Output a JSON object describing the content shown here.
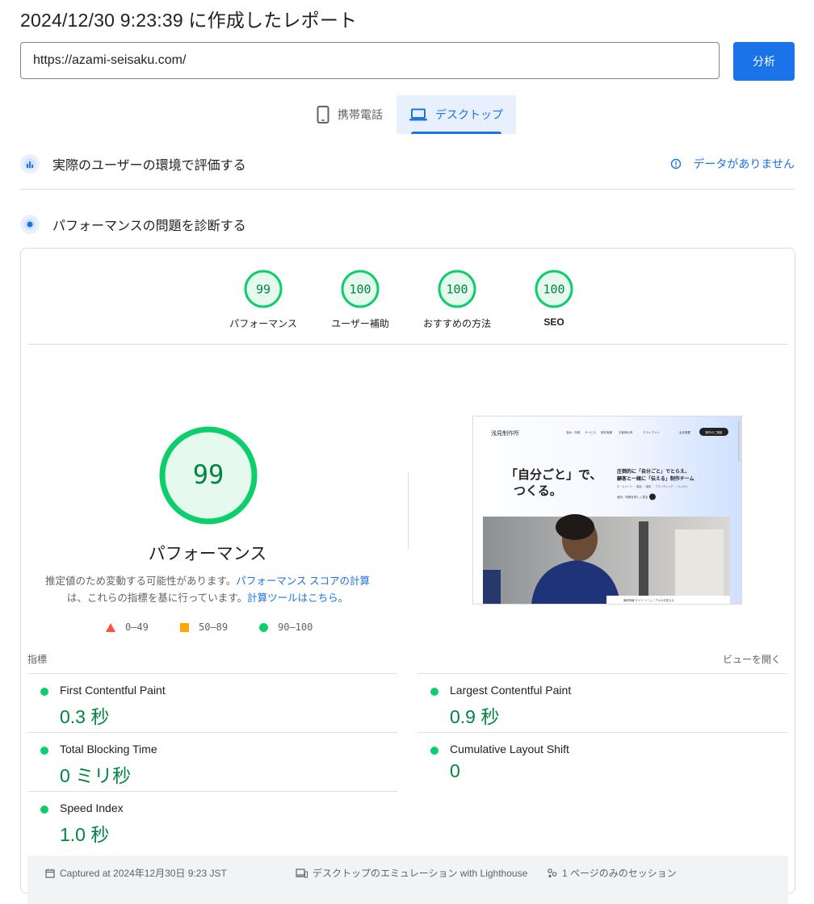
{
  "report": {
    "title": "2024/12/30 9:23:39 に作成したレポート",
    "url": "https://azami-seisaku.com/",
    "analyze_label": "分析"
  },
  "tabs": [
    {
      "label": "携帯電話",
      "icon": "phone-icon",
      "selected": false
    },
    {
      "label": "デスクトップ",
      "icon": "laptop-icon",
      "selected": true
    }
  ],
  "field_section": {
    "title": "実際のユーザーの環境で評価する",
    "icon": "field-data-icon",
    "status": "データがありません",
    "status_icon": "info-icon"
  },
  "lab_section": {
    "title": "パフォーマンスの問題を診断する",
    "icon": "lab-data-icon"
  },
  "scores": [
    {
      "label": "パフォーマンス",
      "value": "99"
    },
    {
      "label": "ユーザー補助",
      "value": "100"
    },
    {
      "label": "おすすめの方法",
      "value": "100"
    },
    {
      "label": "SEO",
      "value": "100"
    }
  ],
  "performance": {
    "score": "99",
    "label": "パフォーマンス",
    "note_prefix": "推定値のため変動する可能性があります。",
    "note_link1": "パフォーマンス スコアの計算",
    "note_middle": "は、これらの指標を基に行っています。",
    "note_link2": "計算ツールはこちら。"
  },
  "legend": [
    {
      "range": "0–49",
      "shape": "triangle",
      "color": "#ff4e42"
    },
    {
      "range": "50–89",
      "shape": "square",
      "color": "#ffa400"
    },
    {
      "range": "90–100",
      "shape": "circle",
      "color": "#0cce6b"
    }
  ],
  "screenshot": {
    "logo": "浅見制作所",
    "nav": [
      "強み・特長",
      "サービス",
      "制作実績",
      "お客様の声",
      "クライアント",
      "会社概要"
    ],
    "nav_cta": "制作のご相談",
    "headline_1": "「自分ごと」で、",
    "headline_2": "つくる。",
    "tagline_1": "圧倒的に「自分ごと」でとらえ、",
    "tagline_2": "顧客と一緒に「伝える」制作チーム",
    "tagline_small": "ホームページ ・ 動画 ・ 撮影 ・ ブランディング ・ コンサル",
    "tagline_link": "強み・特長を詳しく見る",
    "news": "最新情報 サイト リニューアルのお知らせ"
  },
  "metrics": {
    "title": "指標",
    "expand_label": "ビューを開く",
    "items": [
      {
        "name": "First Contentful Paint",
        "value": "0.3 秒"
      },
      {
        "name": "Largest Contentful Paint",
        "value": "0.9 秒"
      },
      {
        "name": "Total Blocking Time",
        "value": "0 ミリ秒"
      },
      {
        "name": "Cumulative Layout Shift",
        "value": "0"
      },
      {
        "name": "Speed Index",
        "value": "1.0 秒"
      }
    ]
  },
  "footer": {
    "captured": "Captured at 2024年12月30日 9:23 JST",
    "emulation": "デスクトップのエミュレーション with Lighthouse",
    "session": "1 ページのみのセッション"
  },
  "colors": {
    "accent": "#1a73e8",
    "pass": "#0cce6b",
    "pass_text": "#018642",
    "average": "#ffa400",
    "fail": "#ff4e42"
  }
}
